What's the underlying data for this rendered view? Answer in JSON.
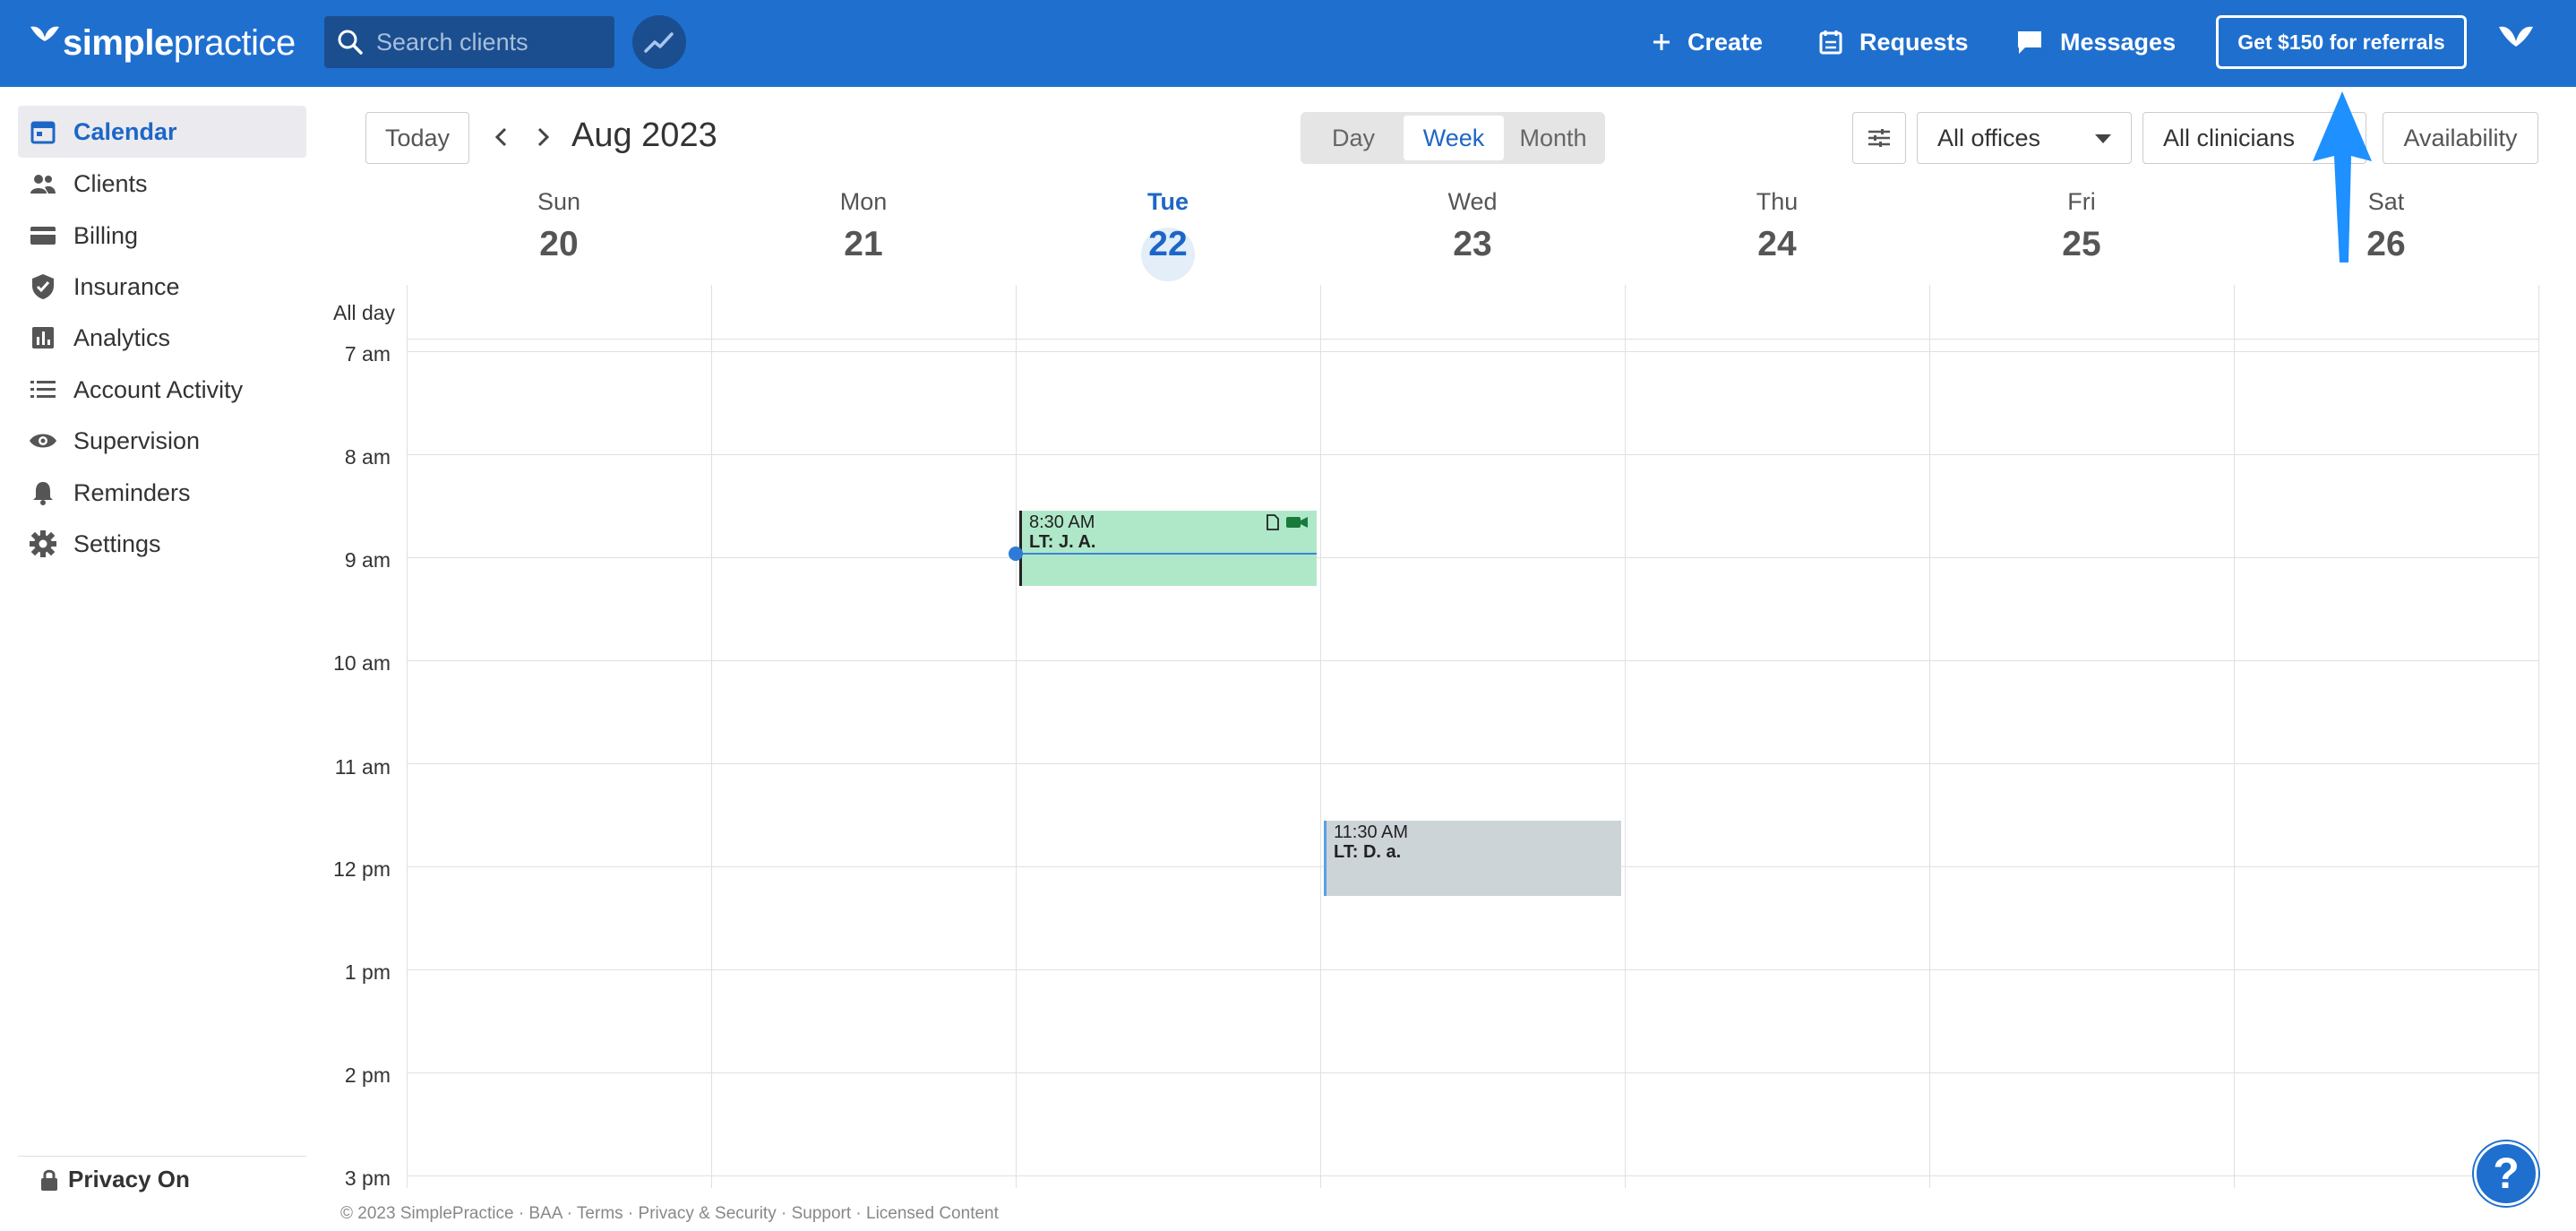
{
  "brand": {
    "logo_bold": "simple",
    "logo_rest": "practice"
  },
  "search": {
    "placeholder": "Search clients"
  },
  "topnav": {
    "create": "Create",
    "requests": "Requests",
    "messages": "Messages",
    "referral": "Get $150 for referrals"
  },
  "sidebar": {
    "items": [
      {
        "label": "Calendar",
        "icon": "calendar-icon",
        "active": true
      },
      {
        "label": "Clients",
        "icon": "people-icon"
      },
      {
        "label": "Billing",
        "icon": "credit-card-icon"
      },
      {
        "label": "Insurance",
        "icon": "shield-check-icon"
      },
      {
        "label": "Analytics",
        "icon": "bar-chart-icon"
      },
      {
        "label": "Account Activity",
        "icon": "list-icon"
      },
      {
        "label": "Supervision",
        "icon": "eye-icon"
      },
      {
        "label": "Reminders",
        "icon": "bell-icon"
      },
      {
        "label": "Settings",
        "icon": "gear-icon"
      }
    ],
    "privacy": "Privacy On"
  },
  "calendar": {
    "today_btn": "Today",
    "period": "Aug 2023",
    "views": {
      "day": "Day",
      "week": "Week",
      "month": "Month",
      "active": "Week"
    },
    "offices": "All offices",
    "clinicians": "All clinicians",
    "availability": "Availability",
    "days": [
      {
        "name": "Sun",
        "date": "20"
      },
      {
        "name": "Mon",
        "date": "21"
      },
      {
        "name": "Tue",
        "date": "22",
        "today": true
      },
      {
        "name": "Wed",
        "date": "23"
      },
      {
        "name": "Thu",
        "date": "24"
      },
      {
        "name": "Fri",
        "date": "25"
      },
      {
        "name": "Sat",
        "date": "26"
      }
    ],
    "all_day": "All day",
    "hours": [
      "7 am",
      "8 am",
      "9 am",
      "10 am",
      "11 am",
      "12 pm",
      "1 pm",
      "2 pm",
      "3 pm"
    ],
    "events": [
      {
        "time": "8:30 AM",
        "title": "LT: J. A.",
        "day": "Tue",
        "color": "#afe8c9"
      },
      {
        "time": "11:30 AM",
        "title": "LT: D. a.",
        "day": "Wed",
        "color": "#cdd4d8"
      }
    ]
  },
  "footer": {
    "text": "© 2023 SimplePractice · BAA · Terms · Privacy & Security · Support · Licensed Content"
  },
  "help": {
    "label": "?"
  },
  "colors": {
    "brand": "#1f6fcf",
    "accent": "#1d66c7",
    "annotation_arrow": "#1e90ff"
  }
}
